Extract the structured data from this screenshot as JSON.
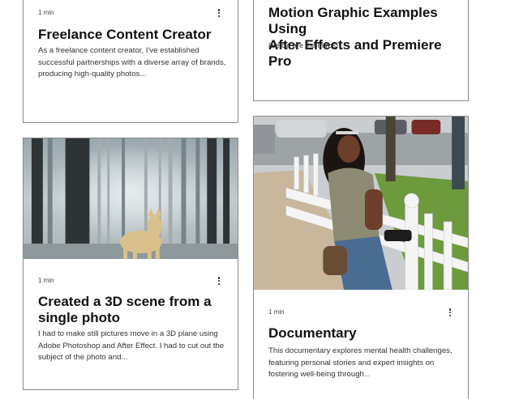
{
  "posts": [
    {
      "read_time": "1 min",
      "title_line1": "Freelance Content Creator",
      "description_lines": [
        "As a freelance content creator, I've established",
        "successful partnerships with a diverse array of brands,",
        "producing high-quality photos..."
      ]
    },
    {
      "title_line1": "Motion Graphic Examples Using",
      "title_line2": "After Effects and Premiere Pro",
      "description_lines": [
        "(Below are the Intros)"
      ]
    },
    {
      "read_time": "1 min",
      "title_line1": "Created a 3D scene from a",
      "title_line2": "single photo",
      "description_lines": [
        "I had to make still pictures move in a 3D plane using",
        "Adobe Photoshop and After Effect. I had to cut out the",
        "subject of the photo and..."
      ]
    },
    {
      "read_time": "1 min",
      "title_line1": "Documentary",
      "description_lines": [
        "This documentary explores mental health challenges,",
        "featuring personal stories and expert insights on",
        "fostering well-being through..."
      ]
    }
  ],
  "icons": {
    "more": "more-vertical-icon"
  }
}
